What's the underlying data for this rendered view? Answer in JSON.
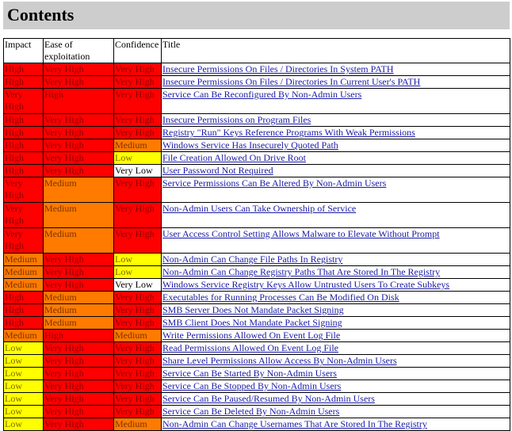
{
  "page": {
    "title": "Contents",
    "columns": {
      "impact": "Impact",
      "ease": "Ease of exploitation",
      "confidence": "Confidence",
      "title": "Title"
    }
  },
  "level_colors": {
    "High": "#ff0000",
    "Very High": "#ff0000",
    "Medium": "#ff7b00",
    "Low": "#ffff00",
    "Very Low": "#ffffff"
  },
  "rows": [
    {
      "impact": "High",
      "ease": "Very High",
      "confidence": "Very High",
      "title": "Insecure Permissions On Files / Directories In System PATH",
      "lines": 1
    },
    {
      "impact": "High",
      "ease": "Very High",
      "confidence": "Very High",
      "title": "Insecure Permissions On Files / Directories In Current User's PATH",
      "lines": 1
    },
    {
      "impact": "Very High",
      "ease": "High",
      "confidence": "Very High",
      "title": "Service Can Be Reconfigured By Non-Admin Users",
      "lines": 2
    },
    {
      "impact": "High",
      "ease": "Very High",
      "confidence": "Very High",
      "title": "Insecure Permissions on Program Files",
      "lines": 1
    },
    {
      "impact": "High",
      "ease": "Very High",
      "confidence": "Very High",
      "title": "Registry \"Run\" Keys Reference Programs With Weak Permissions",
      "lines": 1
    },
    {
      "impact": "High",
      "ease": "Very High",
      "confidence": "Medium",
      "title": "Windows Service Has Insecurely Quoted Path",
      "lines": 1
    },
    {
      "impact": "High",
      "ease": "Very High",
      "confidence": "Low",
      "title": "File Creation Allowed On Drive Root",
      "lines": 1
    },
    {
      "impact": "High",
      "ease": "Very High",
      "confidence": "Very Low",
      "title": "User Password Not Required",
      "lines": 1
    },
    {
      "impact": "Very High",
      "ease": "Medium",
      "confidence": "Very High",
      "title": "Service Permissions Can Be Altered By Non-Admin Users",
      "lines": 2
    },
    {
      "impact": "Very High",
      "ease": "Medium",
      "confidence": "Very High",
      "title": "Non-Admin Users Can Take Ownership of Service",
      "lines": 2
    },
    {
      "impact": "Very High",
      "ease": "Medium",
      "confidence": "Very High",
      "title": "User Access Control Setting Allows Malware to Elevate Without Prompt",
      "lines": 2
    },
    {
      "impact": "Medium",
      "ease": "Very High",
      "confidence": "Low",
      "title": "Non-Admin Can Change File Paths In Registry",
      "lines": 1
    },
    {
      "impact": "Medium",
      "ease": "Very High",
      "confidence": "Low",
      "title": "Non-Admin Can Change Registry Paths That Are Stored In The Registry",
      "lines": 1
    },
    {
      "impact": "Medium",
      "ease": "Very High",
      "confidence": "Very Low",
      "title": "Windows Service Registry Keys Allow Untrusted Users To Create Subkeys",
      "lines": 1
    },
    {
      "impact": "High",
      "ease": "Medium",
      "confidence": "Very High",
      "title": "Executables for Running Processes Can Be Modified On Disk",
      "lines": 1
    },
    {
      "impact": "High",
      "ease": "Medium",
      "confidence": "Very High",
      "title": "SMB Server Does Not Mandate Packet Signing",
      "lines": 1
    },
    {
      "impact": "High",
      "ease": "Medium",
      "confidence": "Very High",
      "title": "SMB Client Does Not Mandate Packet Signing",
      "lines": 1
    },
    {
      "impact": "Medium",
      "ease": "High",
      "confidence": "Medium",
      "title": "Write Permissions Allowed On Event Log File",
      "lines": 1
    },
    {
      "impact": "Low",
      "ease": "Very High",
      "confidence": "Very High",
      "title": "Read Permissions Allowed On Event Log File",
      "lines": 1
    },
    {
      "impact": "Low",
      "ease": "Very High",
      "confidence": "Very High",
      "title": "Share Level Permissions Allow Access By Non-Admin Users",
      "lines": 1
    },
    {
      "impact": "Low",
      "ease": "Very High",
      "confidence": "Very High",
      "title": "Service Can Be Started By Non-Admin Users",
      "lines": 1
    },
    {
      "impact": "Low",
      "ease": "Very High",
      "confidence": "Very High",
      "title": "Service Can Be Stopped By Non-Admin Users",
      "lines": 1
    },
    {
      "impact": "Low",
      "ease": "Very High",
      "confidence": "Very High",
      "title": "Service Can Be Paused/Resumed By Non-Admin Users",
      "lines": 1
    },
    {
      "impact": "Low",
      "ease": "Very High",
      "confidence": "Very High",
      "title": "Service Can Be Deleted By Non-Admin Users",
      "lines": 1
    },
    {
      "impact": "Low",
      "ease": "Very High",
      "confidence": "Medium",
      "title": "Non-Admin Can Change Usernames That Are Stored In The Registry",
      "lines": 1
    }
  ]
}
